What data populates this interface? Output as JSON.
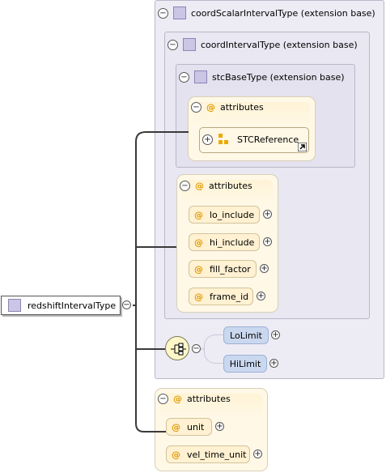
{
  "root": {
    "label": "redshiftIntervalType"
  },
  "ext1": {
    "label": "coordScalarIntervalType (extension base)"
  },
  "ext2": {
    "label": "coordIntervalType (extension base)"
  },
  "ext3": {
    "label": "stcBaseType (extension base)"
  },
  "stc_attributes": {
    "title": "attributes",
    "ref": "STCReference"
  },
  "interval_attributes": {
    "title": "attributes",
    "items": [
      "lo_include",
      "hi_include",
      "fill_factor",
      "frame_id"
    ]
  },
  "choice": {
    "elements": [
      "LoLimit",
      "HiLimit"
    ]
  },
  "own_attributes": {
    "title": "attributes",
    "items": [
      "unit",
      "vel_time_unit"
    ]
  },
  "colors": {
    "extension_box": "#edecf5",
    "attribute_group": "#fff8e6",
    "attribute_pill": "#fff1d2",
    "element_pill": "#cad8ef",
    "at_symbol": "#e09a00",
    "type_icon": "#cbc5e6"
  },
  "icons": [
    "collapse-icon",
    "expand-icon",
    "type-icon",
    "attribute-icon",
    "choice-icon",
    "reference-arrow-icon",
    "group-ref-icon"
  ]
}
